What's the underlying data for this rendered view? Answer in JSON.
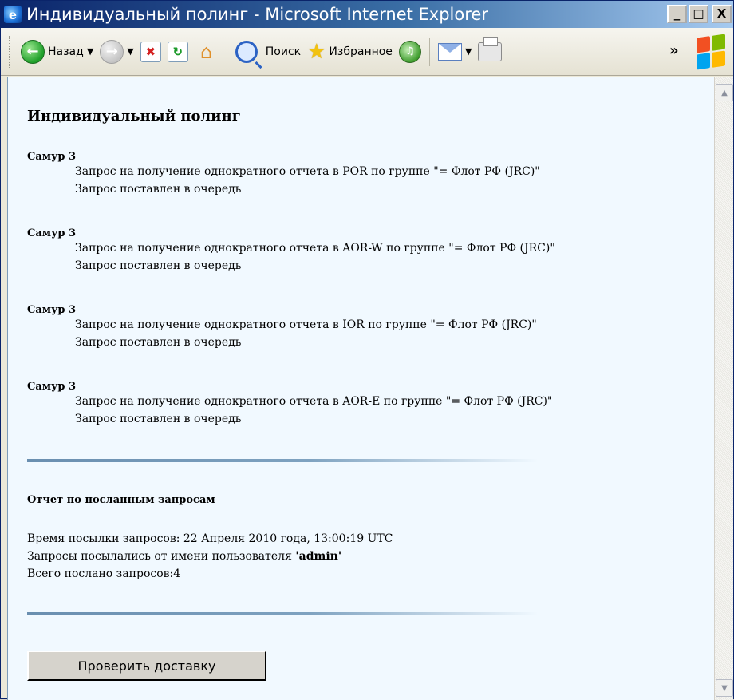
{
  "window": {
    "title": "Индивидуальный полинг - Microsoft Internet Explorer",
    "controls": {
      "minimize": "_",
      "maximize": "□",
      "close": "X"
    }
  },
  "toolbar": {
    "back_label": "Назад",
    "search_label": "Поиск",
    "favorites_label": "Избранное",
    "more": "»",
    "icons": [
      "back-icon",
      "forward-icon",
      "stop-icon",
      "refresh-icon",
      "home-icon",
      "search-icon",
      "favorites-icon",
      "media-icon",
      "mail-icon",
      "print-icon",
      "windows-logo-icon"
    ]
  },
  "page": {
    "title": "Индивидуальный полинг",
    "requests": [
      {
        "source": "Самур 3",
        "text": "Запрос на получение однократного отчета в POR по группе \"= Флот РФ (JRC)\"",
        "status": "Запрос поставлен в очередь"
      },
      {
        "source": "Самур 3",
        "text": "Запрос на получение однократного отчета в AOR-W по группе \"= Флот РФ (JRC)\"",
        "status": "Запрос поставлен в очередь"
      },
      {
        "source": "Самур 3",
        "text": "Запрос на получение однократного отчета в IOR по группе \"= Флот РФ (JRC)\"",
        "status": "Запрос поставлен в очередь"
      },
      {
        "source": "Самур 3",
        "text": "Запрос на получение однократного отчета в AOR-E по группе \"= Флот РФ (JRC)\"",
        "status": "Запрос поставлен в очередь"
      }
    ],
    "summary": {
      "title": "Отчет по посланным запросам",
      "time_line": "Время посылки запросов: 22 Апреля 2010 года, 13:00:19 UTC",
      "user_prefix": "Запросы посылались от имени пользователя ",
      "user_name": "'admin'",
      "total_line": "Всего послано запросов:4"
    },
    "check_button": "Проверить доставку"
  },
  "colors": {
    "page_background": "#f1f9ff",
    "title_bar": "#0a246a",
    "divider": "#6a8fb0"
  }
}
